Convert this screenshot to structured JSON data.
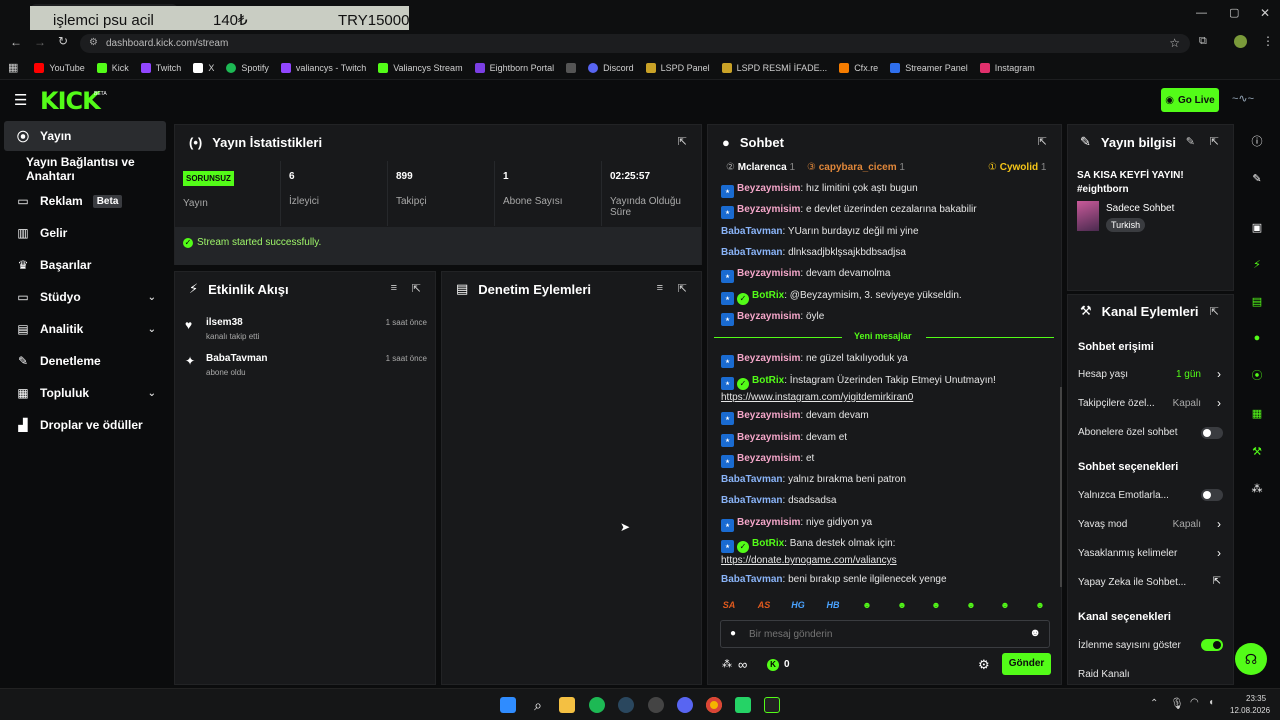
{
  "window": {
    "tab_title": "işlemci psu acil",
    "overlay_price_1": "140₺",
    "overlay_price_2": "TRY15000"
  },
  "browser": {
    "url": "dashboard.kick.com/stream"
  },
  "bookmarks": [
    {
      "label": "YouTube",
      "color": "#ff0000"
    },
    {
      "label": "Kick",
      "color": "#53fc18"
    },
    {
      "label": "Twitch",
      "color": "#9146ff"
    },
    {
      "label": "X",
      "color": "#ffffff"
    },
    {
      "label": "Spotify",
      "color": "#1db954"
    },
    {
      "label": "valiancys - Twitch",
      "color": "#9146ff"
    },
    {
      "label": "Valiancys Stream",
      "color": "#53fc18"
    },
    {
      "label": "Eightborn Portal",
      "color": "#7b3fe4"
    },
    {
      "label": "",
      "color": "#555555"
    },
    {
      "label": "Discord",
      "color": "#5865f2"
    },
    {
      "label": "LSPD Panel",
      "color": "#c9a227"
    },
    {
      "label": "LSPD  RESMİ İFADE...",
      "color": "#c9a227"
    },
    {
      "label": "Cfx.re",
      "color": "#f57c00"
    },
    {
      "label": "Streamer Panel",
      "color": "#2f6fed"
    },
    {
      "label": "Instagram",
      "color": "#e1306c"
    }
  ],
  "header": {
    "logo": "KICK",
    "go_live": "Go Live"
  },
  "nav": [
    {
      "label": "Yayın",
      "icon": "broadcast-icon",
      "glyph": "(•)"
    },
    {
      "label": "Yayın Bağlantısı ve Anahtarı",
      "icon": "",
      "glyph": ""
    },
    {
      "label": "Reklam",
      "icon": "ad-icon",
      "glyph": "▭",
      "badge": "Beta"
    },
    {
      "label": "Gelir",
      "icon": "chart-icon",
      "glyph": "▥"
    },
    {
      "label": "Başarılar",
      "icon": "trophy-icon",
      "glyph": "♛"
    },
    {
      "label": "Stüdyo",
      "icon": "studio-icon",
      "glyph": "▭"
    },
    {
      "label": "Analitik",
      "icon": "analytics-icon",
      "glyph": "▤"
    },
    {
      "label": "Denetleme",
      "icon": "wrench-icon",
      "glyph": "✎"
    },
    {
      "label": "Topluluk",
      "icon": "community-icon",
      "glyph": "▦"
    },
    {
      "label": "Droplar ve ödüller",
      "icon": "drops-icon",
      "glyph": "▟"
    }
  ],
  "stats": {
    "title": "Yayın İstatistikleri",
    "status_badge": "SORUNSUZ",
    "status_label": "Yayın",
    "viewers_value": "6",
    "viewers_label": "İzleyici",
    "followers_value": "899",
    "followers_label": "Takipçi",
    "subs_value": "1",
    "subs_label": "Abone Sayısı",
    "uptime_value": "02:25:57",
    "uptime_label": "Yayında Olduğu Süre",
    "success_msg": "Stream started successfully."
  },
  "activity": {
    "title": "Etkinlik Akışı",
    "items": [
      {
        "name": "ilsem38",
        "desc": "kanalı takip etti",
        "time": "1 saat önce"
      },
      {
        "name": "BabaTavman",
        "desc": "abone oldu",
        "time": "1 saat önce"
      }
    ]
  },
  "moderation": {
    "title": "Denetim Eylemleri"
  },
  "chat": {
    "title": "Sohbet",
    "top_users": [
      {
        "name": "Mclarenca",
        "count": "1"
      },
      {
        "name": "capybara_cicem",
        "count": "1"
      },
      {
        "name": "Cywolid",
        "count": "1"
      }
    ],
    "new_messages_label": "Yeni mesajlar",
    "messages": [
      {
        "user": "Beyzaymisim",
        "text": "hız limitini çok aştı bugun"
      },
      {
        "user": "Beyzaymisim",
        "text": "e devlet üzerinden cezalarına bakabilir"
      },
      {
        "user": "BabaTavman",
        "text": "YUarın burdayız değil mi yine"
      },
      {
        "user": "BabaTavman",
        "text": "dlnksadjbklşsajkbdbsadjsa"
      },
      {
        "user": "Beyzaymisim",
        "text": "devam devamolma"
      },
      {
        "user": "BotRix",
        "text": "@Beyzaymisim, 3. seviyeye yükseldin."
      },
      {
        "user": "Beyzaymisim",
        "text": "öyle"
      },
      {
        "user": "Beyzaymisim",
        "text": "ne güzel takılıyoduk ya"
      },
      {
        "user": "BotRix",
        "text": "İnstagram Üzerinden Takip Etmeyi Unutmayın!",
        "link": "https://www.instagram.com/yigitdemirkiran0"
      },
      {
        "user": "Beyzaymisim",
        "text": "devam devam"
      },
      {
        "user": "Beyzaymisim",
        "text": "devam et"
      },
      {
        "user": "Beyzaymisim",
        "text": "et"
      },
      {
        "user": "BabaTavman",
        "text": "yalnız bırakma beni patron"
      },
      {
        "user": "BabaTavman",
        "text": "dsadsadsa"
      },
      {
        "user": "Beyzaymisim",
        "text": "niye gidiyon ya"
      },
      {
        "user": "BotRix",
        "text": "Bana destek olmak için:",
        "link": "https://donate.bynogame.com/valiancys"
      },
      {
        "user": "BabaTavman",
        "text": "beni bırakıp senle ilgilenecek yenge"
      }
    ],
    "emotes": [
      "SA",
      "AS",
      "HG",
      "HB",
      "☻",
      "☻",
      "☻",
      "☻",
      "☻",
      "☻"
    ],
    "input_placeholder": "Bir mesaj gönderin",
    "infinity": "∞",
    "points": "0",
    "send_label": "Gönder"
  },
  "stream_info": {
    "title": "Yayın bilgisi",
    "stream_title": "SA KISA KEYFİ YAYIN! #eightborn",
    "category": "Sadece Sohbet",
    "language": "Turkish"
  },
  "channel_actions": {
    "title": "Kanal Eylemleri",
    "chat_access": "Sohbet erişimi",
    "account_age_label": "Hesap yaşı",
    "account_age_value": "1 gün",
    "followers_only_label": "Takipçilere özel...",
    "followers_only_value": "Kapalı",
    "subs_only_label": "Abonelere özel sohbet",
    "chat_options": "Sohbet seçenekleri",
    "emotes_only_label": "Yalnızca Emotlarla...",
    "slow_mode_label": "Yavaş mod",
    "slow_mode_value": "Kapalı",
    "banned_words_label": "Yasaklanmış kelimeler",
    "ai_label": "Yapay Zeka ile Sohbet...",
    "channel_options": "Kanal seçenekleri",
    "show_viewers_label": "İzlenme sayısını göster",
    "raid_label": "Raid Kanalı"
  },
  "taskbar": {
    "time": "23:35",
    "date": "12.08.2026"
  }
}
